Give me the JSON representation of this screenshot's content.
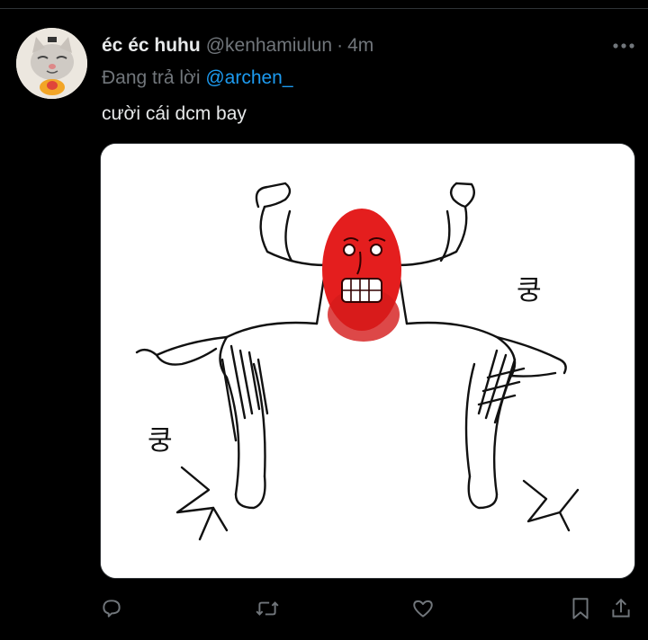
{
  "tweet": {
    "display_name": "éc éc huhu",
    "handle": "@kenhamiulun",
    "separator": "·",
    "time": "4m",
    "replying_prefix": "Đang trả lời",
    "replying_to": "@archen_",
    "text": "cười cái dcm bay"
  },
  "media": {
    "onomatopoeia_right": "쿵",
    "onomatopoeia_left": "쿵"
  },
  "icons": {
    "more": "more-horizontal-icon",
    "reply": "reply-icon",
    "retweet": "retweet-icon",
    "like": "heart-icon",
    "bookmark": "bookmark-icon",
    "share": "share-icon"
  },
  "colors": {
    "background": "#000000",
    "primary_text": "#e7e9ea",
    "secondary_text": "#71767b",
    "link": "#1d9bf0",
    "face_red": "#e41e1e"
  }
}
